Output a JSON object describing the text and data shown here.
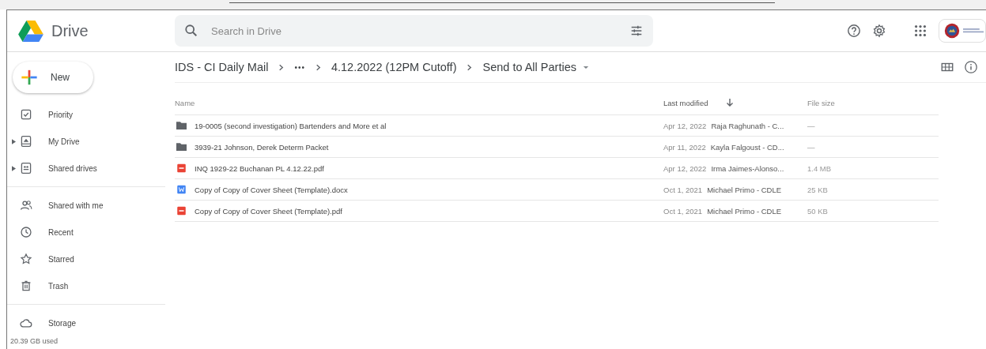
{
  "app": {
    "name": "Drive"
  },
  "search": {
    "placeholder": "Search in Drive"
  },
  "new_button": "New",
  "sidebar": {
    "items": [
      {
        "label": "Priority",
        "expandable": false
      },
      {
        "label": "My Drive",
        "expandable": true
      },
      {
        "label": "Shared drives",
        "expandable": true
      },
      {
        "label": "Shared with me",
        "expandable": false
      },
      {
        "label": "Recent",
        "expandable": false
      },
      {
        "label": "Starred",
        "expandable": false
      },
      {
        "label": "Trash",
        "expandable": false
      }
    ],
    "storage": {
      "label": "Storage",
      "used": "20.39 GB used"
    }
  },
  "breadcrumb": [
    "IDS - CI Daily Mail",
    "•••",
    "4.12.2022 (12PM Cutoff)",
    "Send to All Parties"
  ],
  "table": {
    "columns": [
      "Name",
      "Last modified",
      "File size"
    ],
    "rows": [
      {
        "kind": "folder",
        "name": "19-0005 (second investigation) Bartenders and More et al",
        "date": "Apr 12, 2022",
        "owner": "Raja Raghunath - C...",
        "size": "—"
      },
      {
        "kind": "folder",
        "name": "3939-21 Johnson, Derek Determ Packet",
        "date": "Apr 11, 2022",
        "owner": "Kayla Falgoust - CD...",
        "size": "—"
      },
      {
        "kind": "pdf",
        "name": "INQ 1929-22 Buchanan PL 4.12.22.pdf",
        "date": "Apr 12, 2022",
        "owner": "Irma Jaimes-Alonso...",
        "size": "1.4 MB"
      },
      {
        "kind": "doc",
        "name": "Copy of Copy of Cover Sheet (Template).docx",
        "date": "Oct 1, 2021",
        "owner": "Michael Primo - CDLE",
        "size": "25 KB"
      },
      {
        "kind": "pdf",
        "name": "Copy of Copy of Cover Sheet (Template).pdf",
        "date": "Oct 1, 2021",
        "owner": "Michael Primo - CDLE",
        "size": "50 KB"
      }
    ]
  }
}
